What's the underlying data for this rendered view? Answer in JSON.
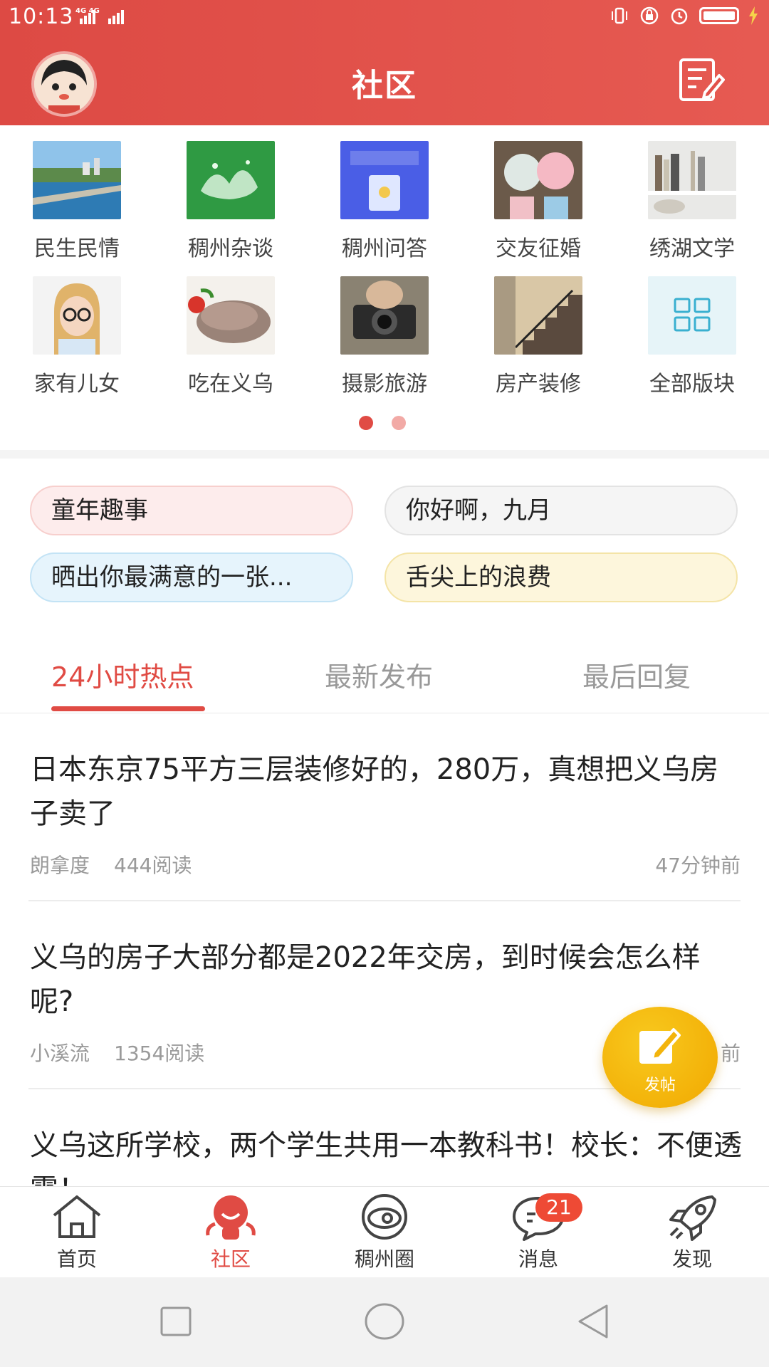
{
  "status_bar": {
    "time": "10:13",
    "network": "4G 4G"
  },
  "header": {
    "title": "社区"
  },
  "categories": [
    {
      "label": "民生民情",
      "icon": "river-city-photo"
    },
    {
      "label": "稠州杂谈",
      "icon": "water-splash-photo"
    },
    {
      "label": "稠州问答",
      "icon": "qa-illustration"
    },
    {
      "label": "交友征婚",
      "icon": "balloons-couple-photo"
    },
    {
      "label": "绣湖文学",
      "icon": "bookshelf-photo"
    },
    {
      "label": "家有儿女",
      "icon": "girl-glasses-photo"
    },
    {
      "label": "吃在义乌",
      "icon": "sliced-meat-photo"
    },
    {
      "label": "摄影旅游",
      "icon": "camera-photo"
    },
    {
      "label": "房产装修",
      "icon": "staircase-photo"
    },
    {
      "label": "全部版块",
      "icon": "grid-icon"
    }
  ],
  "topics": [
    {
      "label": "童年趣事"
    },
    {
      "label": "你好啊，九月"
    },
    {
      "label": "晒出你最满意的一张..."
    },
    {
      "label": "舌尖上的浪费"
    }
  ],
  "tabs": [
    {
      "label": "24小时热点",
      "active": true
    },
    {
      "label": "最新发布",
      "active": false
    },
    {
      "label": "最后回复",
      "active": false
    }
  ],
  "posts": [
    {
      "title": "日本东京75平方三层装修好的，280万，真想把义乌房子卖了",
      "author": "朗拿度",
      "reads": "444阅读",
      "time": "47分钟前"
    },
    {
      "title": "义乌的房子大部分都是2022年交房，到时候会怎么样呢?",
      "author": "小溪流",
      "reads": "1354阅读",
      "time": "前"
    },
    {
      "title": "义乌这所学校，两个学生共用一本教科书！校长：不便透露！"
    }
  ],
  "fab": {
    "label": "发帖"
  },
  "bottom_nav": [
    {
      "label": "首页",
      "icon": "home-icon"
    },
    {
      "label": "社区",
      "icon": "community-mascot-icon",
      "active": true
    },
    {
      "label": "稠州圈",
      "icon": "planet-icon"
    },
    {
      "label": "消息",
      "icon": "chat-icon",
      "badge": "21"
    },
    {
      "label": "发现",
      "icon": "rocket-icon"
    }
  ],
  "colors": {
    "brand_red": "#e2514a",
    "active_text": "#e04b44",
    "fab_yellow": "#f3b40c",
    "badge_red": "#ee4a35"
  }
}
